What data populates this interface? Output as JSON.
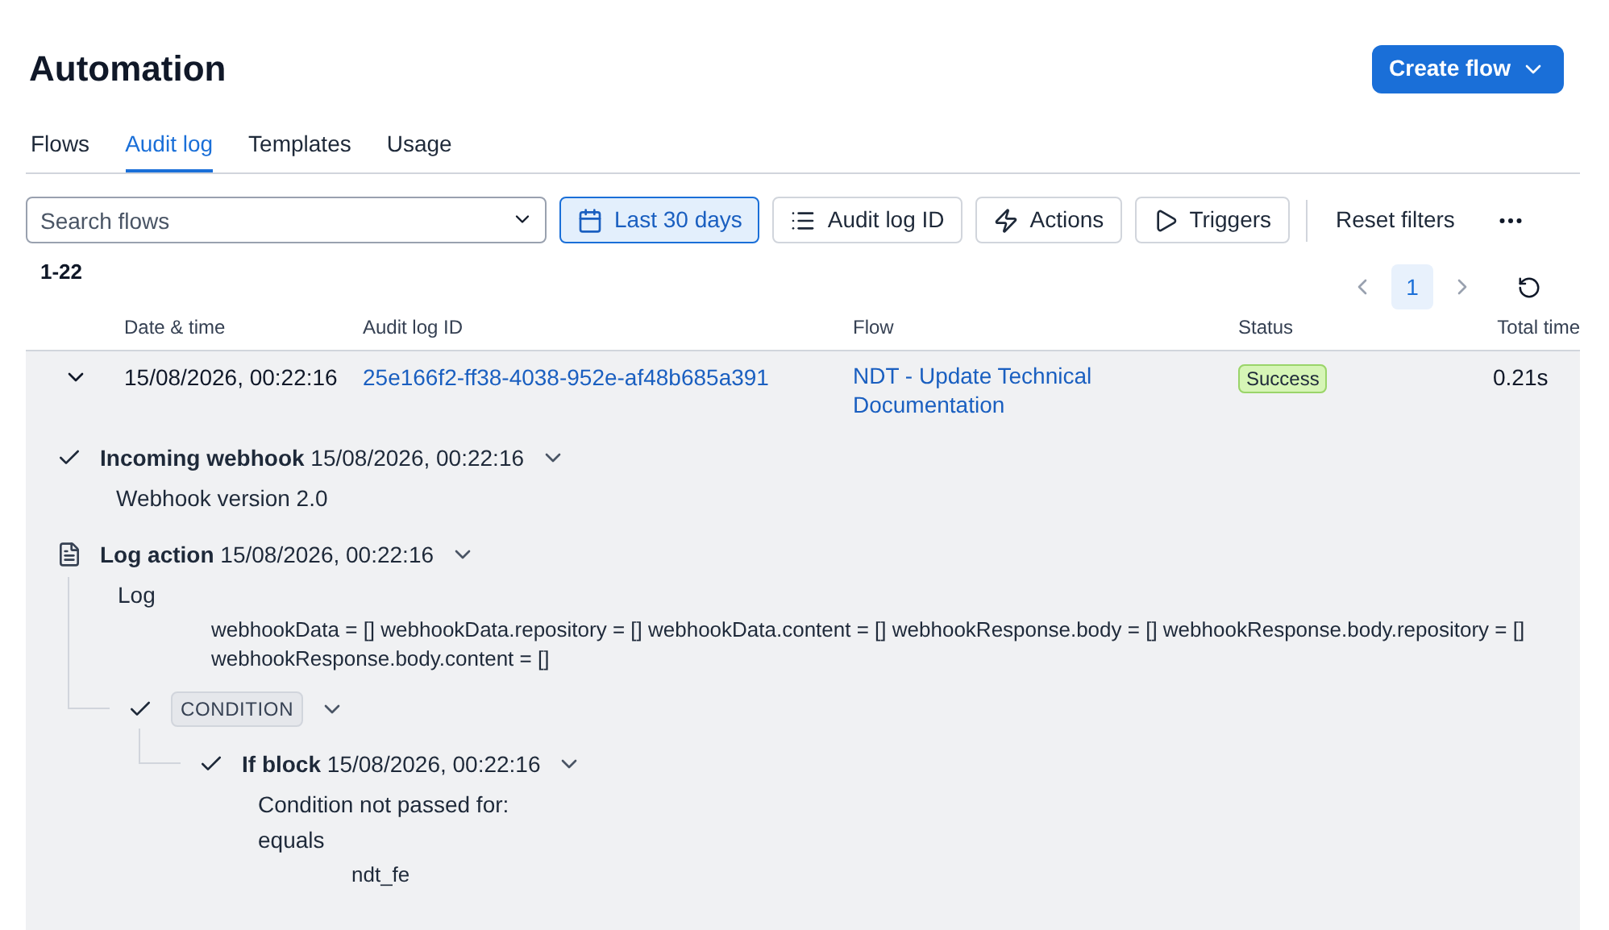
{
  "page_title": "Automation",
  "create_button": "Create flow",
  "tabs": [
    {
      "label": "Flows",
      "selected": false
    },
    {
      "label": "Audit log",
      "selected": true
    },
    {
      "label": "Templates",
      "selected": false
    },
    {
      "label": "Usage",
      "selected": false
    }
  ],
  "search": {
    "placeholder": "Search flows"
  },
  "filters": [
    {
      "kind": "calendar",
      "label": "Last 30 days",
      "active": true
    },
    {
      "kind": "list",
      "label": "Audit log ID",
      "active": false
    },
    {
      "kind": "bolt",
      "label": "Actions",
      "active": false
    },
    {
      "kind": "play",
      "label": "Triggers",
      "active": false
    }
  ],
  "reset_label": "Reset filters",
  "range": "1-22",
  "pages": [
    {
      "label": "1",
      "selected": true
    }
  ],
  "table": {
    "columns": [
      "Date & time",
      "Audit log ID",
      "Flow",
      "Status",
      "Total time"
    ],
    "rows": [
      {
        "expanded": true,
        "date": "15/08/2026, 00:22:16",
        "audit_id": "25e166f2-ff38-4038-952e-af48b685a391",
        "flow": "NDT - Update Technical Documentation",
        "status": "Success",
        "total_time": "0.21s"
      }
    ]
  },
  "steps": [
    {
      "kind": "check",
      "title": "Incoming webhook",
      "time": "15/08/2026, 00:22:16",
      "lines": [
        {
          "kind": "plain",
          "text": "Webhook version 2.0"
        }
      ]
    },
    {
      "kind": "log",
      "title": "Log action",
      "time": "15/08/2026, 00:22:16",
      "lines": [
        {
          "kind": "plain",
          "text": "Log"
        },
        {
          "kind": "indented",
          "text": "webhookData = [] webhookData.repository = [] webhookData.content = [] webhookResponse.body = [] webhookResponse.body.repository = [] webhookResponse.body.content = []"
        }
      ],
      "children": [
        {
          "kind": "check",
          "badge": "CONDITION",
          "children": [
            {
              "kind": "check",
              "title": "If block",
              "time": "15/08/2026, 00:22:16",
              "lines": [
                {
                  "kind": "plain",
                  "text": "Condition not passed for:"
                },
                {
                  "kind": "plain",
                  "text": "equals"
                },
                {
                  "kind": "indented",
                  "text": "ndt_fe"
                }
              ]
            }
          ]
        }
      ]
    }
  ]
}
